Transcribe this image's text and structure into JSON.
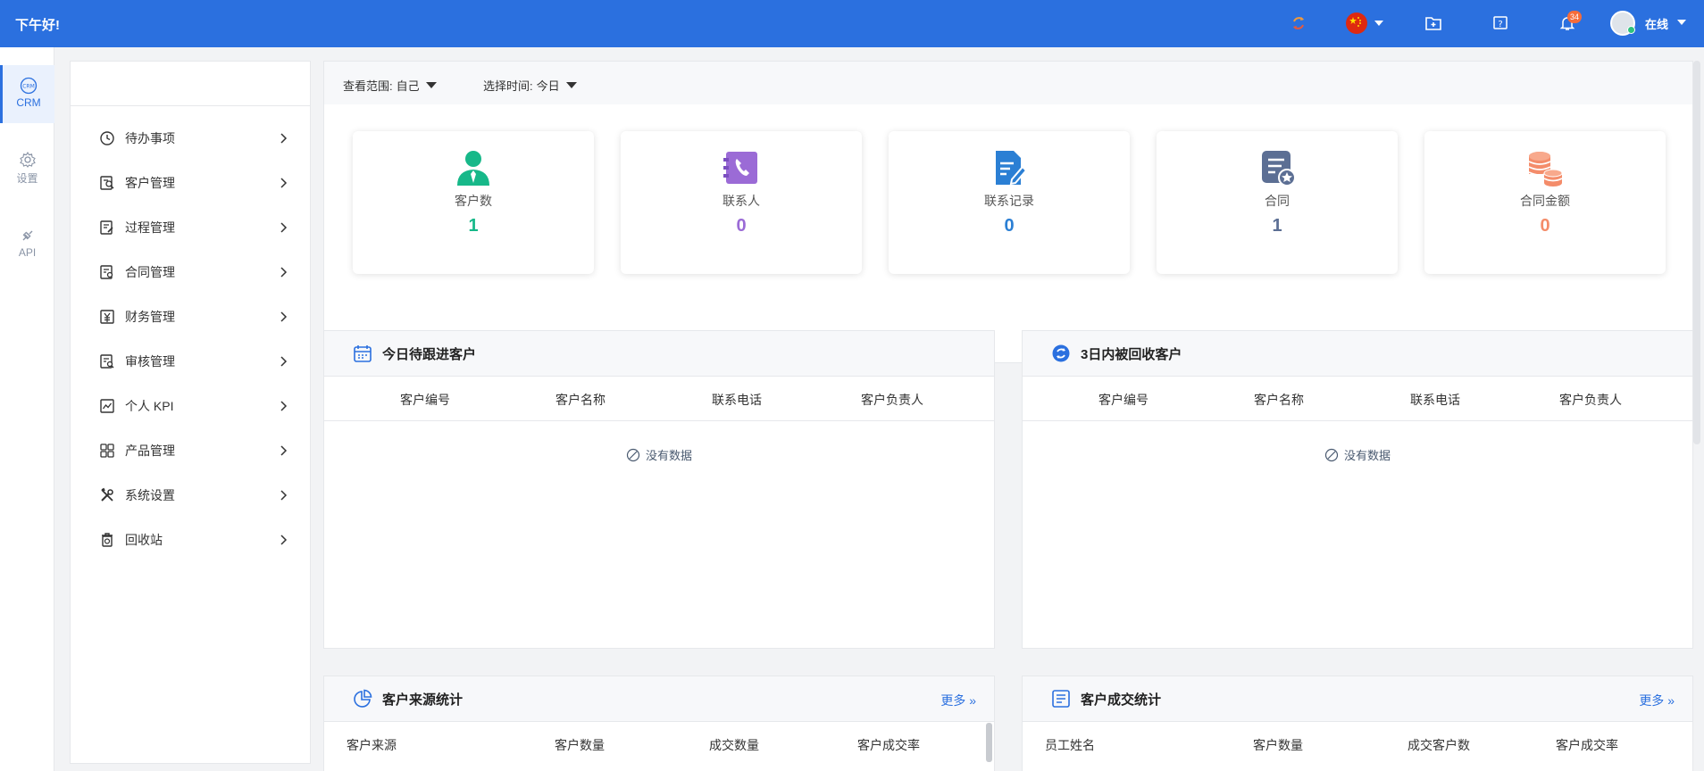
{
  "header": {
    "greeting": "下午好!",
    "notifications_count": "34",
    "user_status": "在线"
  },
  "rail": {
    "items": [
      {
        "label": "CRM",
        "icon": "crm-icon",
        "active": true
      },
      {
        "label": "设置",
        "icon": "gear-icon",
        "active": false
      },
      {
        "label": "API",
        "icon": "plug-icon",
        "active": false
      }
    ]
  },
  "sidebar": {
    "items": [
      {
        "label": "待办事项",
        "icon": "clock-icon"
      },
      {
        "label": "客户管理",
        "icon": "customer-icon"
      },
      {
        "label": "过程管理",
        "icon": "process-icon"
      },
      {
        "label": "合同管理",
        "icon": "contract-icon"
      },
      {
        "label": "财务管理",
        "icon": "finance-icon"
      },
      {
        "label": "审核管理",
        "icon": "audit-icon"
      },
      {
        "label": "个人 KPI",
        "icon": "kpi-icon"
      },
      {
        "label": "产品管理",
        "icon": "product-icon"
      },
      {
        "label": "系统设置",
        "icon": "tools-icon"
      },
      {
        "label": "回收站",
        "icon": "trash-icon"
      }
    ]
  },
  "filters": {
    "scope_label": "查看范围:",
    "scope_value": "自己",
    "time_label": "选择时间:",
    "time_value": "今日"
  },
  "stats": [
    {
      "label": "客户数",
      "value": "1",
      "color": "#17b889",
      "icon": "customer-person-icon"
    },
    {
      "label": "联系人",
      "value": "0",
      "color": "#9b6bd6",
      "icon": "phone-book-icon"
    },
    {
      "label": "联系记录",
      "value": "0",
      "color": "#2b7fd4",
      "icon": "edit-doc-icon"
    },
    {
      "label": "合同",
      "value": "1",
      "color": "#5c6f94",
      "icon": "contract-star-icon"
    },
    {
      "label": "合同金额",
      "value": "0",
      "color": "#f48c6a",
      "icon": "coins-icon"
    }
  ],
  "panels": {
    "followup": {
      "title": "今日待跟进客户",
      "columns": [
        "客户编号",
        "客户名称",
        "联系电话",
        "客户负责人"
      ],
      "empty": "没有数据"
    },
    "recycled": {
      "title": "3日内被回收客户",
      "columns": [
        "客户编号",
        "客户名称",
        "联系电话",
        "客户负责人"
      ],
      "empty": "没有数据"
    },
    "source": {
      "title": "客户来源统计",
      "more": "更多",
      "columns": [
        "客户来源",
        "客户数量",
        "成交数量",
        "客户成交率"
      ]
    },
    "deal": {
      "title": "客户成交统计",
      "more": "更多",
      "columns": [
        "员工姓名",
        "客户数量",
        "成交客户数",
        "客户成交率"
      ]
    }
  },
  "colors": {
    "primary": "#2b70df"
  }
}
